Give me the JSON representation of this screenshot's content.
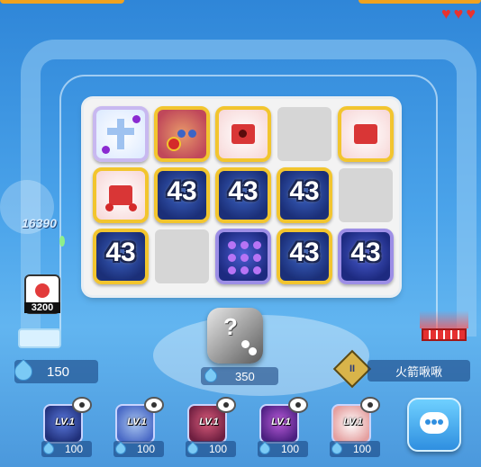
{
  "hud": {
    "lives": 3,
    "energy": "150",
    "dice_cost": "350",
    "player_name": "火箭啾啾"
  },
  "enemy": {
    "hp": "16390",
    "boss_hp": "3200"
  },
  "board": {
    "row1": [
      "cross",
      "body",
      "hat",
      "empty",
      "hat"
    ],
    "row2": [
      "hat",
      "43",
      "43",
      "43",
      "empty"
    ],
    "row3": [
      "43",
      "empty",
      "dots",
      "43",
      "43"
    ],
    "label43": "43"
  },
  "shop": [
    {
      "level": "LV.1",
      "cost": "100"
    },
    {
      "level": "LV.1",
      "cost": "100"
    },
    {
      "level": "LV.1",
      "cost": "100"
    },
    {
      "level": "LV.1",
      "cost": "100"
    },
    {
      "level": "LV.1",
      "cost": "100"
    }
  ],
  "rank_badge": "II"
}
